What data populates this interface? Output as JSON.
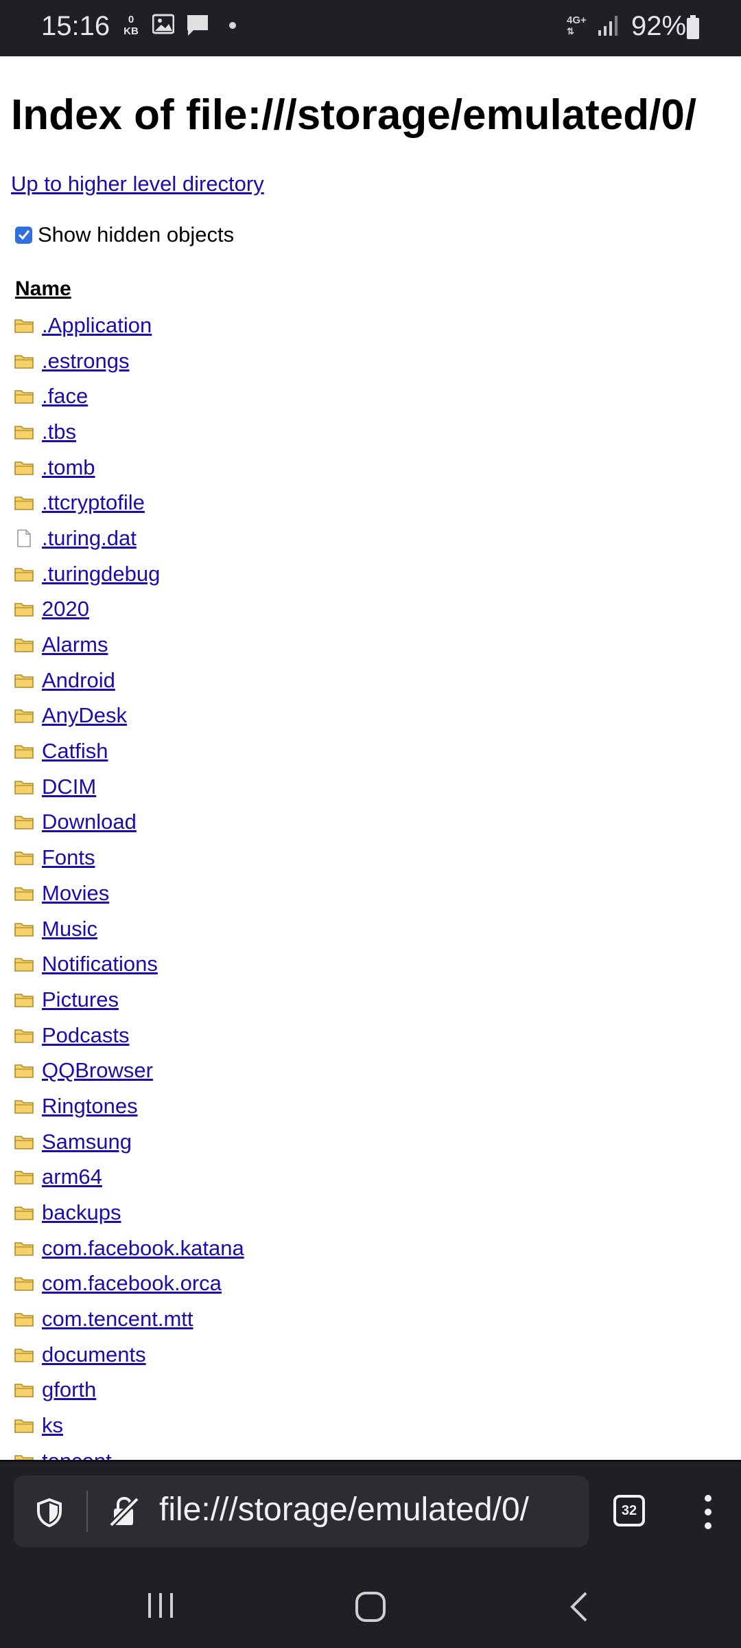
{
  "status_bar": {
    "time": "15:16",
    "data_speed_value": "0",
    "data_speed_unit": "KB",
    "network": "4G+",
    "battery": "92%"
  },
  "page": {
    "title": "Index of file:///storage/emulated/0/",
    "up_link": "Up to higher level directory",
    "show_hidden_label": "Show hidden objects",
    "show_hidden_checked": true,
    "column_name": "Name",
    "entries": [
      {
        "name": ".Application",
        "type": "folder"
      },
      {
        "name": ".estrongs",
        "type": "folder"
      },
      {
        "name": ".face",
        "type": "folder"
      },
      {
        "name": ".tbs",
        "type": "folder"
      },
      {
        "name": ".tomb",
        "type": "folder"
      },
      {
        "name": ".ttcryptofile",
        "type": "folder"
      },
      {
        "name": ".turing.dat",
        "type": "file"
      },
      {
        "name": ".turingdebug",
        "type": "folder"
      },
      {
        "name": "2020",
        "type": "folder"
      },
      {
        "name": "Alarms",
        "type": "folder"
      },
      {
        "name": "Android",
        "type": "folder"
      },
      {
        "name": "AnyDesk",
        "type": "folder"
      },
      {
        "name": "Catfish",
        "type": "folder"
      },
      {
        "name": "DCIM",
        "type": "folder"
      },
      {
        "name": "Download",
        "type": "folder"
      },
      {
        "name": "Fonts",
        "type": "folder"
      },
      {
        "name": "Movies",
        "type": "folder"
      },
      {
        "name": "Music",
        "type": "folder"
      },
      {
        "name": "Notifications",
        "type": "folder"
      },
      {
        "name": "Pictures",
        "type": "folder"
      },
      {
        "name": "Podcasts",
        "type": "folder"
      },
      {
        "name": "QQBrowser",
        "type": "folder"
      },
      {
        "name": "Ringtones",
        "type": "folder"
      },
      {
        "name": "Samsung",
        "type": "folder"
      },
      {
        "name": "arm64",
        "type": "folder"
      },
      {
        "name": "backups",
        "type": "folder"
      },
      {
        "name": "com.facebook.katana",
        "type": "folder"
      },
      {
        "name": "com.facebook.orca",
        "type": "folder"
      },
      {
        "name": "com.tencent.mtt",
        "type": "folder"
      },
      {
        "name": "documents",
        "type": "folder"
      },
      {
        "name": "gforth",
        "type": "folder"
      },
      {
        "name": "ks",
        "type": "folder"
      },
      {
        "name": "tencent",
        "type": "folder"
      }
    ]
  },
  "toolbar": {
    "url": "file:///storage/emulated/0/",
    "tab_count": "32"
  },
  "colors": {
    "link": "#1a0dab",
    "checkbox": "#2f6fe0",
    "folder": "#f5d16a",
    "chrome": "#1f1f25"
  }
}
